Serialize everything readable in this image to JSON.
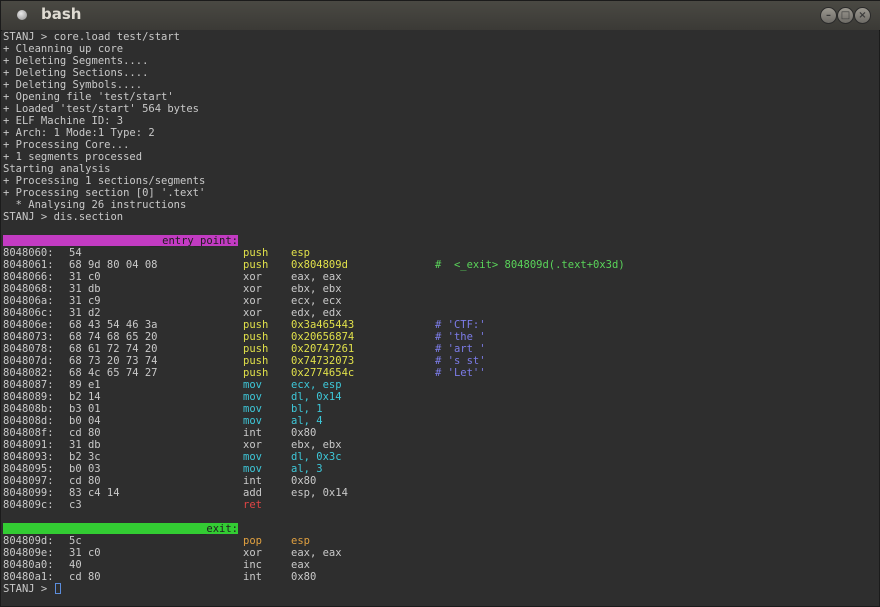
{
  "window": {
    "title": "bash"
  },
  "terminal": {
    "prompt": "STANJ > ",
    "top_lines": [
      "STANJ > core.load test/start",
      "+ Cleanning up core",
      "+ Deleting Segments....",
      "+ Deleting Sections....",
      "+ Deleting Symbols....",
      "+ Opening file 'test/start'",
      "+ Loaded 'test/start' 564 bytes",
      "+ ELF Machine ID: 3",
      "+ Arch: 1 Mode:1 Type: 2",
      "+ Processing Core...",
      "+ 1 segments processed",
      "Starting analysis",
      "+ Processing 1 sections/segments",
      "+ Processing section [0] '.text'",
      "  * Analysing 26 instructions",
      "STANJ > dis.section"
    ],
    "entry_label": "__entry_point:",
    "entry_rows": [
      {
        "addr": "8048060:",
        "hex": "54",
        "op": "push",
        "arg": "esp",
        "cmt": "",
        "cls": "push-op"
      },
      {
        "addr": "8048061:",
        "hex": "68 9d 80 04 08",
        "op": "push",
        "arg": "0x804809d",
        "cmt": "#  <_exit> 804809d(.text+0x3d)",
        "cls": "push-op"
      },
      {
        "addr": "8048066:",
        "hex": "31 c0",
        "op": "xor",
        "arg": "eax, eax",
        "cmt": "",
        "cls": ""
      },
      {
        "addr": "8048068:",
        "hex": "31 db",
        "op": "xor",
        "arg": "ebx, ebx",
        "cmt": "",
        "cls": ""
      },
      {
        "addr": "804806a:",
        "hex": "31 c9",
        "op": "xor",
        "arg": "ecx, ecx",
        "cmt": "",
        "cls": ""
      },
      {
        "addr": "804806c:",
        "hex": "31 d2",
        "op": "xor",
        "arg": "edx, edx",
        "cmt": "",
        "cls": ""
      },
      {
        "addr": "804806e:",
        "hex": "68 43 54 46 3a",
        "op": "push",
        "arg": "0x3a465443",
        "cmt": "# 'CTF:'",
        "cls": "push"
      },
      {
        "addr": "8048073:",
        "hex": "68 74 68 65 20",
        "op": "push",
        "arg": "0x20656874",
        "cmt": "# 'the '",
        "cls": "push"
      },
      {
        "addr": "8048078:",
        "hex": "68 61 72 74 20",
        "op": "push",
        "arg": "0x20747261",
        "cmt": "# 'art '",
        "cls": "push"
      },
      {
        "addr": "804807d:",
        "hex": "68 73 20 73 74",
        "op": "push",
        "arg": "0x74732073",
        "cmt": "# 's st'",
        "cls": "push"
      },
      {
        "addr": "8048082:",
        "hex": "68 4c 65 74 27",
        "op": "push",
        "arg": "0x2774654c",
        "cmt": "# 'Let''",
        "cls": "push"
      },
      {
        "addr": "8048087:",
        "hex": "89 e1",
        "op": "mov",
        "arg": "ecx, esp",
        "cmt": "",
        "cls": "mov"
      },
      {
        "addr": "8048089:",
        "hex": "b2 14",
        "op": "mov",
        "arg": "dl, 0x14",
        "cmt": "",
        "cls": "mov"
      },
      {
        "addr": "804808b:",
        "hex": "b3 01",
        "op": "mov",
        "arg": "bl, 1",
        "cmt": "",
        "cls": "mov"
      },
      {
        "addr": "804808d:",
        "hex": "b0 04",
        "op": "mov",
        "arg": "al, 4",
        "cmt": "",
        "cls": "mov"
      },
      {
        "addr": "804808f:",
        "hex": "cd 80",
        "op": "int",
        "arg": "0x80",
        "cmt": "",
        "cls": ""
      },
      {
        "addr": "8048091:",
        "hex": "31 db",
        "op": "xor",
        "arg": "ebx, ebx",
        "cmt": "",
        "cls": ""
      },
      {
        "addr": "8048093:",
        "hex": "b2 3c",
        "op": "mov",
        "arg": "dl, 0x3c",
        "cmt": "",
        "cls": "mov"
      },
      {
        "addr": "8048095:",
        "hex": "b0 03",
        "op": "mov",
        "arg": "al, 3",
        "cmt": "",
        "cls": "mov"
      },
      {
        "addr": "8048097:",
        "hex": "cd 80",
        "op": "int",
        "arg": "0x80",
        "cmt": "",
        "cls": ""
      },
      {
        "addr": "8048099:",
        "hex": "83 c4 14",
        "op": "add",
        "arg": "esp, 0x14",
        "cmt": "",
        "cls": ""
      },
      {
        "addr": "804809c:",
        "hex": "c3",
        "op": "ret",
        "arg": "",
        "cmt": "",
        "cls": "ret"
      }
    ],
    "exit_label": "_exit:",
    "exit_rows": [
      {
        "addr": "804809d:",
        "hex": "5c",
        "op": "pop",
        "arg": "esp",
        "cmt": "",
        "cls": "pop"
      },
      {
        "addr": "804809e:",
        "hex": "31 c0",
        "op": "xor",
        "arg": "eax, eax",
        "cmt": "",
        "cls": ""
      },
      {
        "addr": "80480a0:",
        "hex": "40",
        "op": "inc",
        "arg": "eax",
        "cmt": "",
        "cls": ""
      },
      {
        "addr": "80480a1:",
        "hex": "cd 80",
        "op": "int",
        "arg": "0x80",
        "cmt": "",
        "cls": ""
      }
    ]
  },
  "colors": {
    "entry_label_bg": "#c23bc2",
    "exit_label_bg": "#33cc33",
    "push": "#e0e04a",
    "mov": "#3ec7d8",
    "ret": "#e04545",
    "pop": "#e0a040",
    "comment_address": "#5ad45a",
    "comment_string": "#7c7ce8"
  }
}
